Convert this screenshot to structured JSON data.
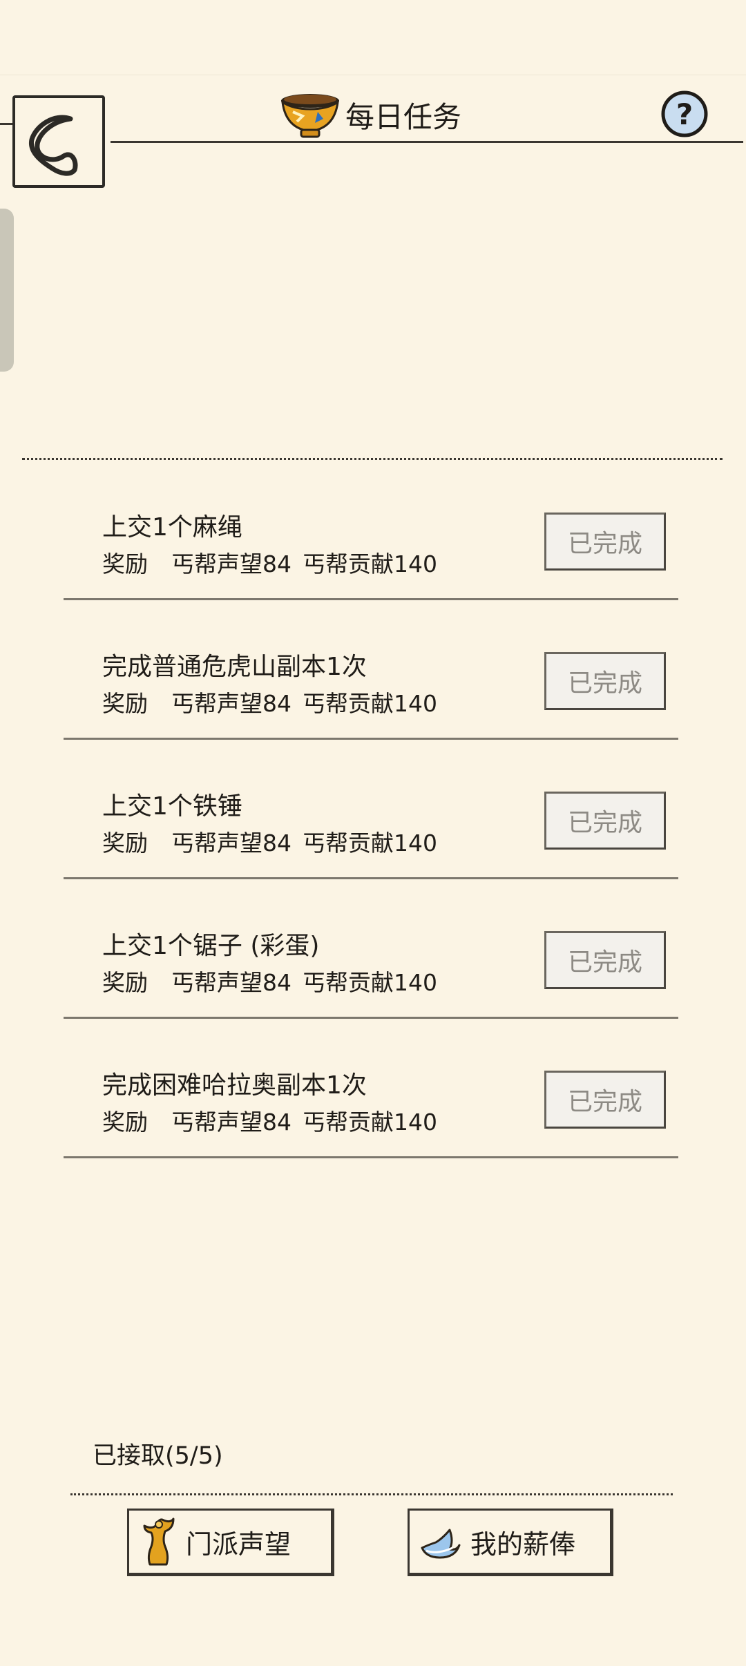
{
  "header": {
    "title": "每日任务",
    "title_icon": "golden-bowl-icon",
    "back_icon": "chevron-left-icon",
    "help_icon": "question-icon"
  },
  "tasks": [
    {
      "title": "上交1个麻绳",
      "reward_label": "奖励",
      "reward_1": "丐帮声望84",
      "reward_2": "丐帮贡献140",
      "status": "已完成"
    },
    {
      "title": "完成普通危虎山副本1次",
      "reward_label": "奖励",
      "reward_1": "丐帮声望84",
      "reward_2": "丐帮贡献140",
      "status": "已完成"
    },
    {
      "title": "上交1个铁锤",
      "reward_label": "奖励",
      "reward_1": "丐帮声望84",
      "reward_2": "丐帮贡献140",
      "status": "已完成"
    },
    {
      "title": "上交1个锯子 (彩蛋)",
      "reward_label": "奖励",
      "reward_1": "丐帮声望84",
      "reward_2": "丐帮贡献140",
      "status": "已完成"
    },
    {
      "title": "完成困难哈拉奥副本1次",
      "reward_label": "奖励",
      "reward_1": "丐帮声望84",
      "reward_2": "丐帮贡献140",
      "status": "已完成"
    }
  ],
  "footer": {
    "accepted": "已接取(5/5)",
    "sect_reputation": {
      "label": "门派声望",
      "icon": "golden-statue-icon"
    },
    "my_salary": {
      "label": "我的薪俸",
      "icon": "silver-ingot-icon"
    }
  },
  "colors": {
    "background": "#fbf4e4",
    "ink": "#2c2a26",
    "done_text": "#8d8a84"
  }
}
